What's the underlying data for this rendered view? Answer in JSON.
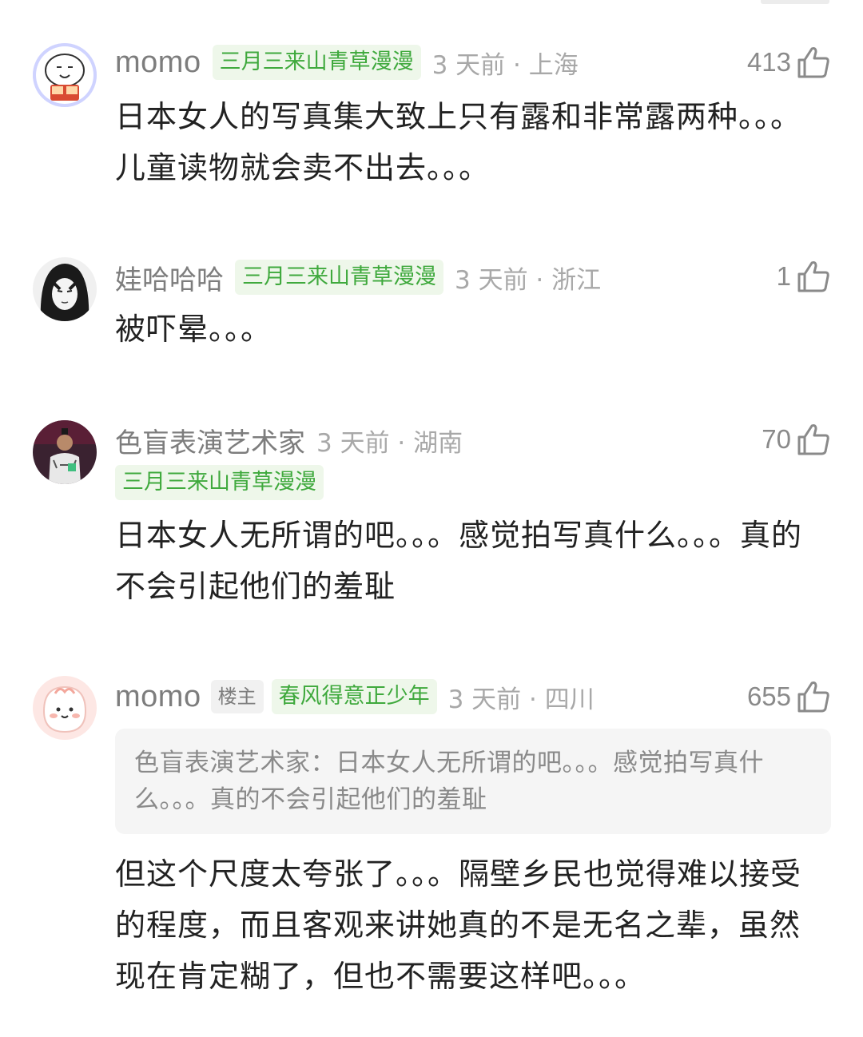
{
  "comments": [
    {
      "username": "momo",
      "badge": "三月三来山青草漫漫",
      "meta": "3 天前 · 上海",
      "likes": "413",
      "text": "日本女人的写真集大致上只有露和非常露两种。。。儿童读物就会卖不出去。。。"
    },
    {
      "username": "娃哈哈哈",
      "badge": "三月三来山青草漫漫",
      "meta": "3 天前 · 浙江",
      "likes": "1",
      "text": "被吓晕。。。"
    },
    {
      "username": "色盲表演艺术家",
      "badge": "三月三来山青草漫漫",
      "meta": "3 天前 · 湖南",
      "likes": "70",
      "text": "日本女人无所谓的吧。。。感觉拍写真什么。。。真的不会引起他们的羞耻"
    },
    {
      "username": "momo",
      "op_badge": "楼主",
      "badge": "春风得意正少年",
      "meta": "3 天前 · 四川",
      "likes": "655",
      "quote": "色盲表演艺术家：日本女人无所谓的吧。。。感觉拍写真什么。。。真的不会引起他们的羞耻",
      "text": "但这个尺度太夸张了。。。隔壁乡民也觉得难以接受的程度，而且客观来讲她真的不是无名之辈，虽然现在肯定糊了，但也不需要这样吧。。。"
    }
  ],
  "icons": {
    "like": "thumbs-up-outline-icon"
  },
  "colors": {
    "badge_text": "#3fa93d",
    "badge_bg": "#eef7ea",
    "username": "#7d7d7d",
    "meta": "#a8a8a8",
    "body_text": "#222222"
  }
}
